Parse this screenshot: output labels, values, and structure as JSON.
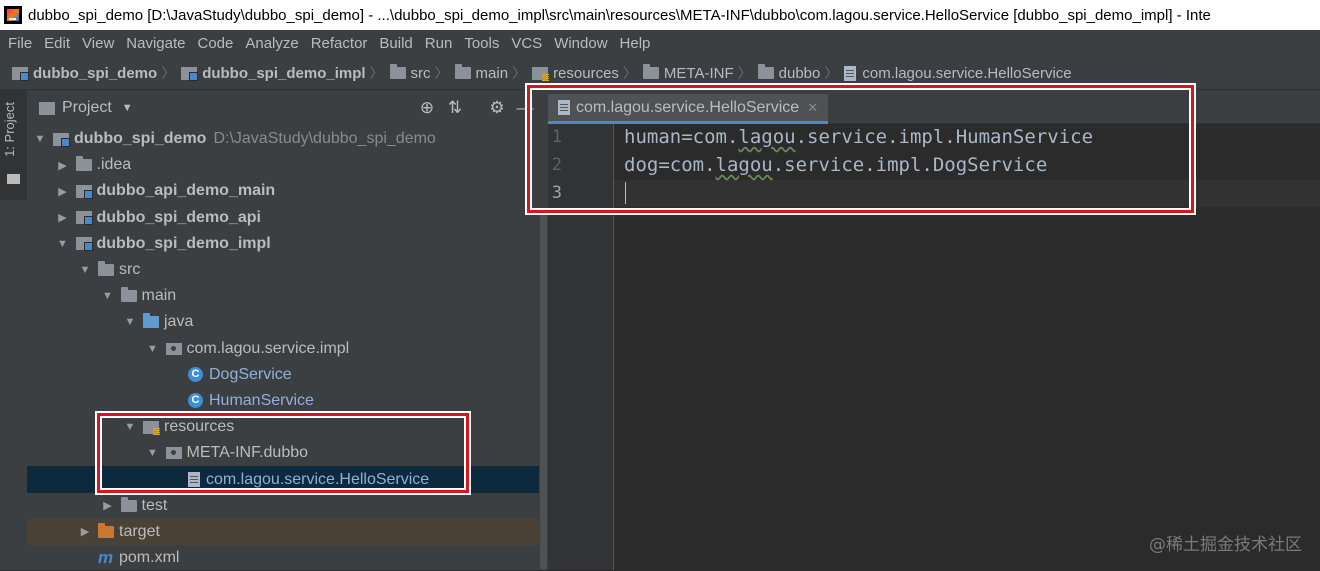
{
  "window": {
    "title": "dubbo_spi_demo [D:\\JavaStudy\\dubbo_spi_demo] - ...\\dubbo_spi_demo_impl\\src\\main\\resources\\META-INF\\dubbo\\com.lagou.service.HelloService [dubbo_spi_demo_impl] - Inte"
  },
  "menu": [
    "File",
    "Edit",
    "View",
    "Navigate",
    "Code",
    "Analyze",
    "Refactor",
    "Build",
    "Run",
    "Tools",
    "VCS",
    "Window",
    "Help"
  ],
  "breadcrumb": [
    {
      "label": "dubbo_spi_demo",
      "icon": "module-icon"
    },
    {
      "label": "dubbo_spi_demo_impl",
      "icon": "module-icon"
    },
    {
      "label": "src",
      "icon": "folder-icon"
    },
    {
      "label": "main",
      "icon": "folder-icon"
    },
    {
      "label": "resources",
      "icon": "resources-folder-icon"
    },
    {
      "label": "META-INF",
      "icon": "folder-icon"
    },
    {
      "label": "dubbo",
      "icon": "folder-icon"
    },
    {
      "label": "com.lagou.service.HelloService",
      "icon": "file-icon"
    }
  ],
  "side_strip": {
    "label": "1: Project"
  },
  "project_panel": {
    "title": "Project",
    "tree": [
      {
        "label": "dubbo_spi_demo",
        "path": "D:\\JavaStudy\\dubbo_spi_demo",
        "icon": "module-icon",
        "arrow": "down",
        "depth": 0,
        "bold": true
      },
      {
        "label": ".idea",
        "icon": "folder-icon",
        "arrow": "right",
        "depth": 1
      },
      {
        "label": "dubbo_api_demo_main",
        "icon": "module-icon",
        "arrow": "right",
        "depth": 1,
        "bold": true
      },
      {
        "label": "dubbo_spi_demo_api",
        "icon": "module-icon",
        "arrow": "right",
        "depth": 1,
        "bold": true
      },
      {
        "label": "dubbo_spi_demo_impl",
        "icon": "module-icon",
        "arrow": "down",
        "depth": 1,
        "bold": true
      },
      {
        "label": "src",
        "icon": "folder-icon",
        "arrow": "down",
        "depth": 2
      },
      {
        "label": "main",
        "icon": "folder-icon",
        "arrow": "down",
        "depth": 3
      },
      {
        "label": "java",
        "icon": "source-folder-icon",
        "arrow": "down",
        "depth": 4
      },
      {
        "label": "com.lagou.service.impl",
        "icon": "package-icon",
        "arrow": "down",
        "depth": 5
      },
      {
        "label": "DogService",
        "icon": "class-icon",
        "arrow": "none",
        "depth": 6,
        "blue": true
      },
      {
        "label": "HumanService",
        "icon": "class-icon",
        "arrow": "none",
        "depth": 6,
        "blue": true
      },
      {
        "label": "resources",
        "icon": "resources-folder-icon",
        "arrow": "down",
        "depth": 4
      },
      {
        "label": "META-INF.dubbo",
        "icon": "package-icon",
        "arrow": "down",
        "depth": 5
      },
      {
        "label": "com.lagou.service.HelloService",
        "icon": "file-icon",
        "arrow": "none",
        "depth": 6,
        "selected": true,
        "blue": true
      },
      {
        "label": "test",
        "icon": "folder-icon",
        "arrow": "right",
        "depth": 3
      },
      {
        "label": "target",
        "icon": "excluded-folder-icon",
        "arrow": "right",
        "depth": 2,
        "target": true
      },
      {
        "label": "pom.xml",
        "icon": "maven-icon",
        "arrow": "none",
        "depth": 2
      }
    ]
  },
  "editor": {
    "tab_label": "com.lagou.service.HelloService",
    "lines": [
      {
        "num": "1",
        "segments": [
          {
            "t": "human=com."
          },
          {
            "t": "lagou",
            "squiggle": true
          },
          {
            "t": ".service.impl.HumanService"
          }
        ]
      },
      {
        "num": "2",
        "segments": [
          {
            "t": "dog=com."
          },
          {
            "t": "lagou",
            "squiggle": true
          },
          {
            "t": ".service.impl.DogService"
          }
        ]
      },
      {
        "num": "3",
        "segments": []
      }
    ]
  },
  "watermark": "@稀土掘金技术社区",
  "colors": {
    "highlight_box": "#d6161d",
    "accent": "#4a88c7",
    "selection": "#0d293e"
  }
}
